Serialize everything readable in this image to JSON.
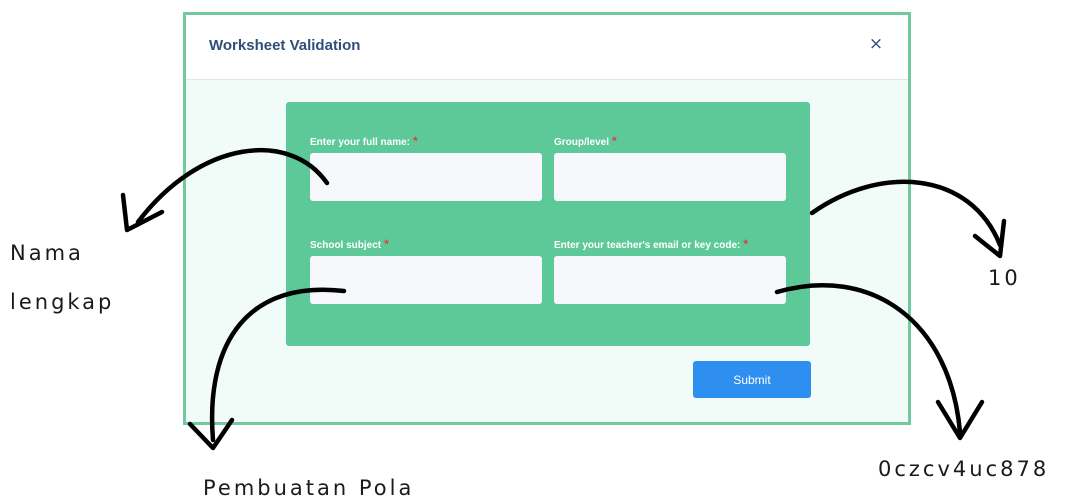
{
  "modal": {
    "title": "Worksheet Validation",
    "close_glyph": "×",
    "colors": {
      "border": "#72c9a0",
      "panel": "#5dc999",
      "title": "#2f4f7a",
      "submit": "#2e8ff0",
      "required": "#e23b3b"
    }
  },
  "form": {
    "fields": [
      {
        "label": "Enter your full name:",
        "required": "*",
        "value": ""
      },
      {
        "label": "Group/level",
        "required": "*",
        "value": ""
      },
      {
        "label": "School subject",
        "required": "*",
        "value": ""
      },
      {
        "label": "Enter your teacher's email or key code:",
        "required": "*",
        "value": ""
      }
    ],
    "submit_label": "Submit"
  },
  "annotations": {
    "name_line1": "Nama",
    "name_line2": "lengkap",
    "group": "10",
    "subject": "Pembuatan Pola",
    "code": "0czcv4uc878"
  }
}
